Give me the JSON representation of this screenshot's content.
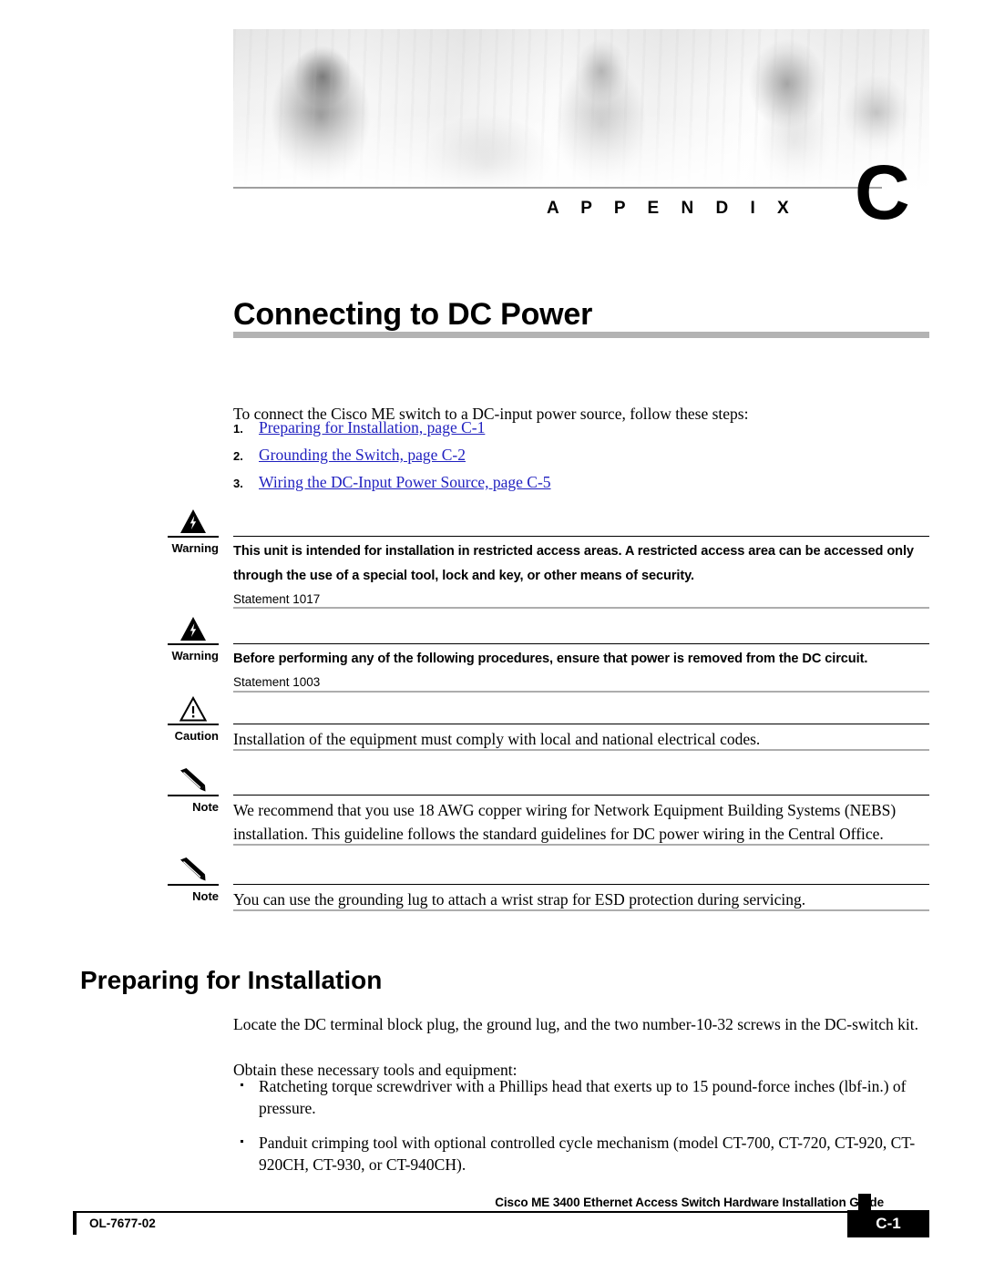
{
  "header": {
    "appendix_word": "A P P E N D I X",
    "appendix_letter": "C",
    "banner_icon": "people-collaborating-photo"
  },
  "chapter": {
    "title": "Connecting to DC Power"
  },
  "intro": {
    "text": "To connect the Cisco ME switch to a DC-input power source, follow these steps:"
  },
  "steps": [
    {
      "num": "1.",
      "label": "Preparing for Installation, page C-1"
    },
    {
      "num": "2.",
      "label": "Grounding the Switch, page C-2"
    },
    {
      "num": "3.",
      "label": "Wiring the DC-Input Power Source, page C-5"
    }
  ],
  "admonitions": [
    {
      "kind": "warning",
      "icon": "warning-lightning-triangle-icon",
      "label": "Warning",
      "text": "This unit is intended for installation in restricted access areas. A restricted access area can be accessed only through the use of a special tool, lock and key, or other means of security.",
      "statement": "Statement 1017"
    },
    {
      "kind": "warning",
      "icon": "warning-lightning-triangle-icon",
      "label": "Warning",
      "text": "Before performing any of the following procedures, ensure that power is removed from the DC circuit.",
      "statement": "Statement 1003"
    },
    {
      "kind": "caution",
      "icon": "caution-exclamation-triangle-icon",
      "label": "Caution",
      "text": "Installation of the equipment must comply with local and national electrical codes.",
      "statement": ""
    },
    {
      "kind": "note",
      "icon": "note-pencil-icon",
      "label": "Note",
      "text": "We recommend that you use 18 AWG copper wiring for Network Equipment Building Systems (NEBS) installation. This guideline follows the standard guidelines for DC power wiring in the Central Office.",
      "statement": ""
    },
    {
      "kind": "note",
      "icon": "note-pencil-icon",
      "label": "Note",
      "text": "You can use the grounding lug to attach a wrist strap for ESD protection during servicing.",
      "statement": ""
    }
  ],
  "section": {
    "heading": "Preparing for Installation",
    "paragraph_1": "Locate the DC terminal block plug, the ground lug, and the two number-10-32 screws in the DC-switch kit.",
    "paragraph_2": "Obtain these necessary tools and equipment:"
  },
  "bullets": [
    "Ratcheting torque screwdriver with a Phillips head that exerts up to 15 pound-force inches (lbf-in.) of pressure.",
    "Panduit crimping tool with optional controlled cycle mechanism (model CT-700, CT-720, CT-920, CT-920CH, CT-930, or CT-940CH)."
  ],
  "footer": {
    "guide_title": "Cisco ME 3400 Ethernet Access Switch Hardware Installation Guide",
    "doc_number": "OL-7677-02",
    "page_number": "C-1"
  },
  "colors": {
    "link": "#1f1fbf",
    "title_rule": "#b3b3b3",
    "adm_bottom_rule": "#adadad"
  }
}
